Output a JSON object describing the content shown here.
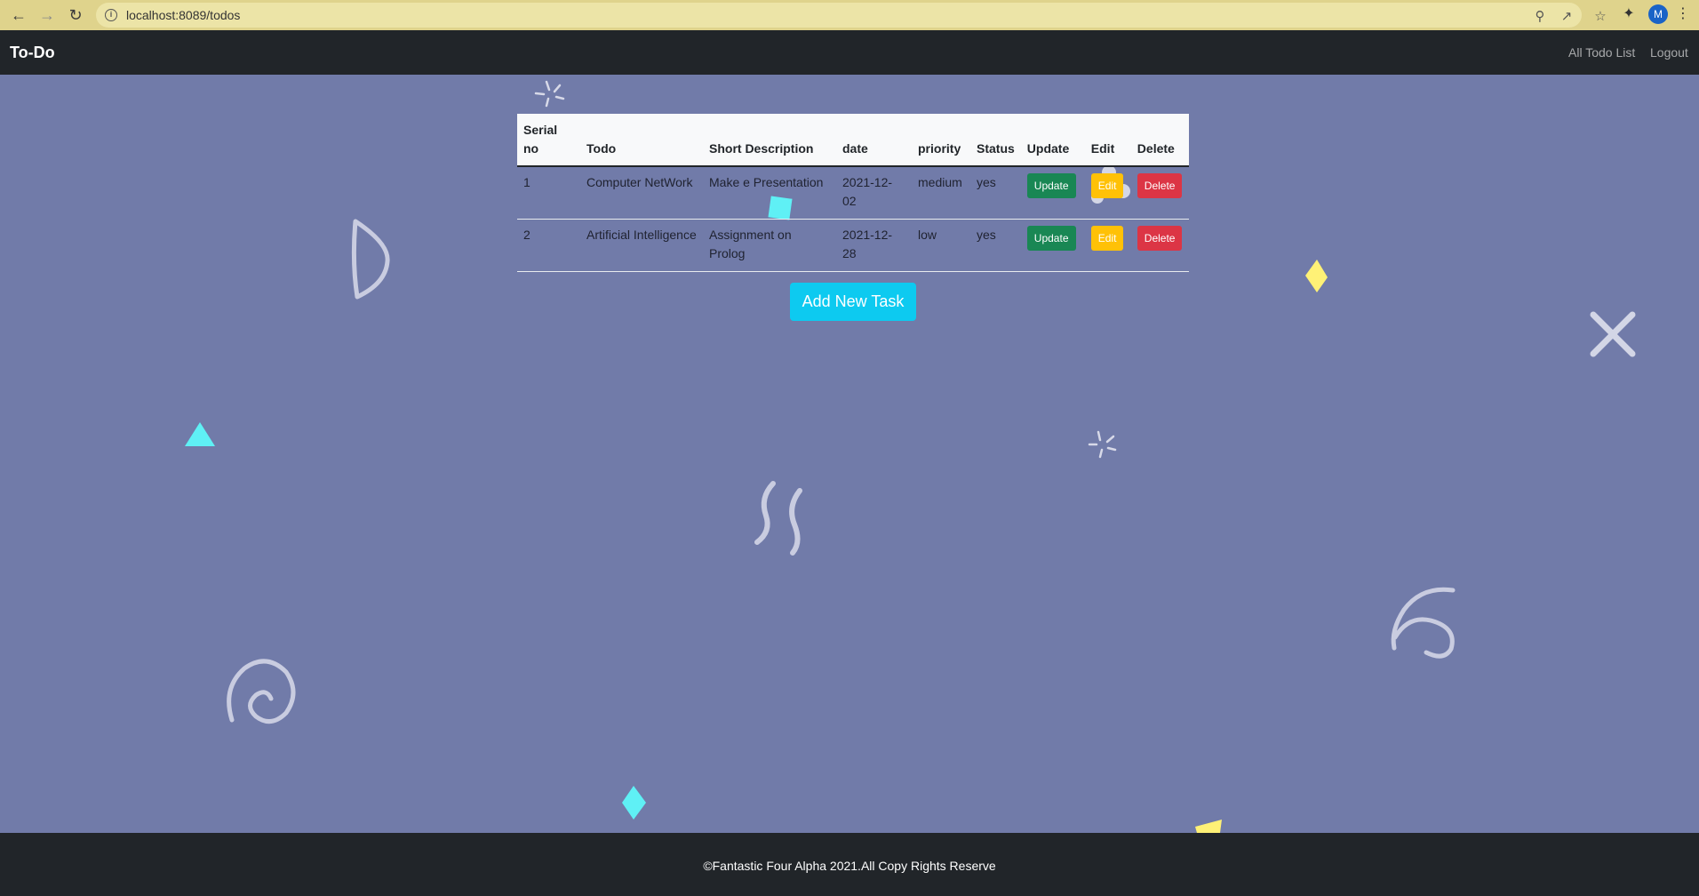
{
  "browser": {
    "url": "localhost:8089/todos",
    "profile_initial": "M",
    "icons": [
      "back-icon",
      "forward-icon",
      "reload-icon",
      "info-icon",
      "zoom-icon",
      "share-icon",
      "star-icon",
      "extensions-icon",
      "menu-icon"
    ]
  },
  "navbar": {
    "brand": "To-Do",
    "links": [
      "All Todo List",
      "Logout"
    ]
  },
  "table": {
    "headers": [
      "Serial no",
      "Todo",
      "Short Description",
      "date",
      "priority",
      "Status",
      "Update",
      "Edit",
      "Delete"
    ],
    "rows": [
      {
        "serial": "1",
        "todo": "Computer NetWork",
        "description": "Make e Presentation",
        "date": "2021-12-02",
        "priority": "medium",
        "status": "yes",
        "update_label": "Update",
        "edit_label": "Edit",
        "delete_label": "Delete"
      },
      {
        "serial": "2",
        "todo": "Artificial Intelligence",
        "description": "Assignment on Prolog",
        "date": "2021-12-28",
        "priority": "low",
        "status": "yes",
        "update_label": "Update",
        "edit_label": "Edit",
        "delete_label": "Delete"
      }
    ]
  },
  "add_button_label": "Add New Task",
  "footer": {
    "text": "©Fantastic Four Alpha 2021.All Copy Rights Reserve"
  },
  "colors": {
    "background": "#717ba9",
    "navbar": "#212529",
    "success": "#198754",
    "warning": "#ffc107",
    "danger": "#dc3545",
    "info": "#0dcaf0",
    "confetti_cyan": "#5ff0f5",
    "confetti_yellow": "#fff176",
    "confetti_squiggle": "#c9cce0"
  }
}
